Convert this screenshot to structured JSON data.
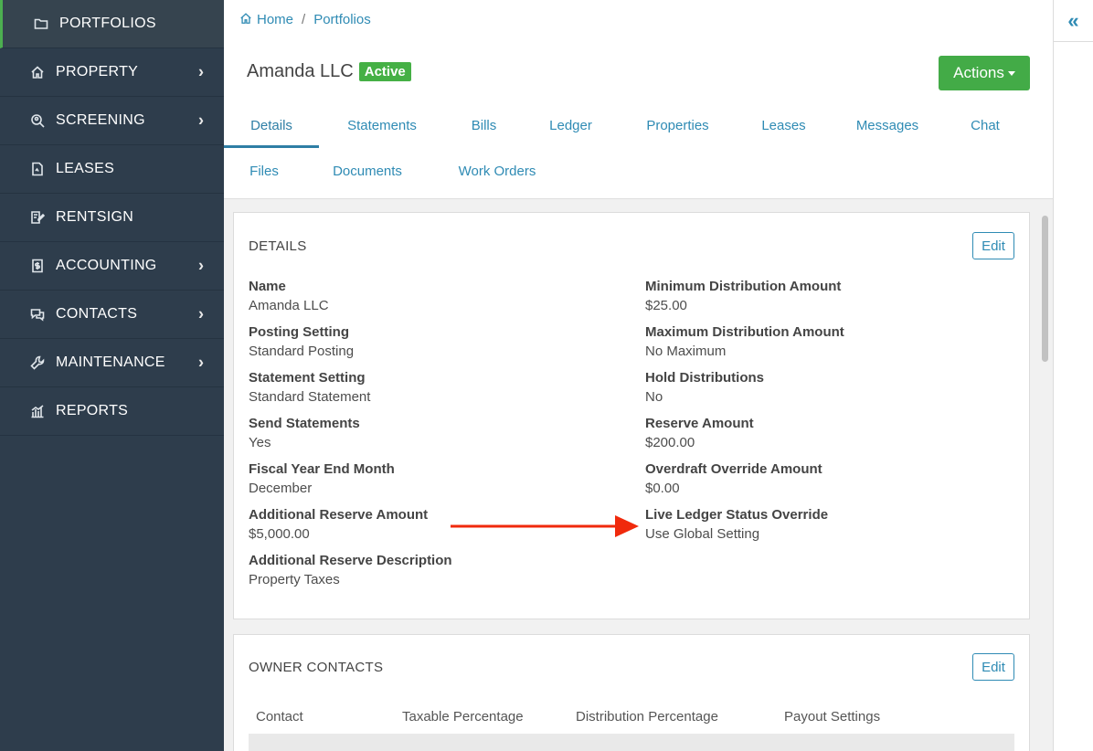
{
  "sidebar": {
    "items": [
      {
        "label": "PORTFOLIOS",
        "icon": "folder-icon",
        "active": true,
        "has_submenu": false
      },
      {
        "label": "PROPERTY",
        "icon": "home-icon",
        "active": false,
        "has_submenu": true
      },
      {
        "label": "SCREENING",
        "icon": "search-icon",
        "active": false,
        "has_submenu": true
      },
      {
        "label": "LEASES",
        "icon": "document-icon",
        "active": false,
        "has_submenu": false
      },
      {
        "label": "RENTSIGN",
        "icon": "sign-icon",
        "active": false,
        "has_submenu": false
      },
      {
        "label": "ACCOUNTING",
        "icon": "dollar-document-icon",
        "active": false,
        "has_submenu": true
      },
      {
        "label": "CONTACTS",
        "icon": "chat-icon",
        "active": false,
        "has_submenu": true
      },
      {
        "label": "MAINTENANCE",
        "icon": "wrench-icon",
        "active": false,
        "has_submenu": true
      },
      {
        "label": "REPORTS",
        "icon": "bar-chart-icon",
        "active": false,
        "has_submenu": false
      }
    ],
    "chevron": "›"
  },
  "breadcrumb": {
    "home": "Home",
    "separator": "/",
    "current": "Portfolios"
  },
  "page": {
    "title": "Amanda LLC",
    "status": "Active",
    "actions_label": "Actions"
  },
  "tabs": {
    "row1": [
      "Details",
      "Statements",
      "Bills",
      "Ledger",
      "Properties",
      "Leases",
      "Messages",
      "Chat"
    ],
    "row2": [
      "Files",
      "Documents",
      "Work Orders"
    ],
    "active": "Details"
  },
  "details": {
    "title": "DETAILS",
    "edit_label": "Edit",
    "left": [
      {
        "label": "Name",
        "value": "Amanda LLC"
      },
      {
        "label": "Posting Setting",
        "value": "Standard Posting"
      },
      {
        "label": "Statement Setting",
        "value": "Standard Statement"
      },
      {
        "label": "Send Statements",
        "value": "Yes"
      },
      {
        "label": "Fiscal Year End Month",
        "value": "December"
      },
      {
        "label": "Additional Reserve Amount",
        "value": "$5,000.00"
      },
      {
        "label": "Additional Reserve Description",
        "value": "Property Taxes"
      }
    ],
    "right": [
      {
        "label": "Minimum Distribution Amount",
        "value": "$25.00"
      },
      {
        "label": "Maximum Distribution Amount",
        "value": "No Maximum"
      },
      {
        "label": "Hold Distributions",
        "value": "No"
      },
      {
        "label": "Reserve Amount",
        "value": "$200.00"
      },
      {
        "label": "Overdraft Override Amount",
        "value": "$0.00"
      },
      {
        "label": "Live Ledger Status Override",
        "value": "Use Global Setting"
      }
    ]
  },
  "owner_contacts": {
    "title": "OWNER CONTACTS",
    "edit_label": "Edit",
    "columns": [
      "Contact",
      "Taxable Percentage",
      "Distribution Percentage",
      "Payout Settings"
    ]
  },
  "right_panel": {
    "collapse_glyph": "«"
  },
  "colors": {
    "sidebar_bg": "#2e3d4c",
    "accent_blue": "#2f8bb4",
    "active_green": "#45b045",
    "annotation_red": "#f02a0c"
  }
}
